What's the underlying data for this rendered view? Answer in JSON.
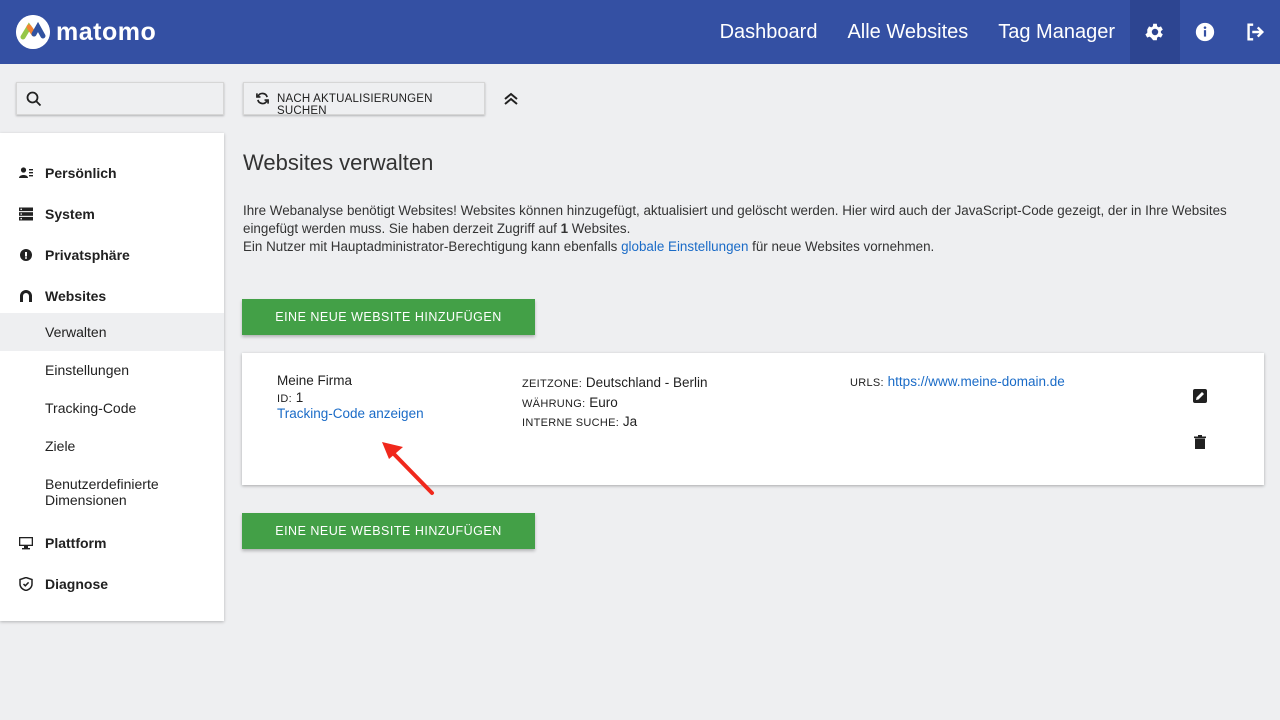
{
  "app": {
    "logo_text": "matomo"
  },
  "topnav": {
    "links": [
      "Dashboard",
      "Alle Websites",
      "Tag Manager"
    ],
    "icons": [
      "gear-icon",
      "info-icon",
      "logout-icon"
    ]
  },
  "search": {
    "placeholder": ""
  },
  "sidebar": {
    "categories": [
      {
        "label": "Persönlich",
        "icon": "user-icon"
      },
      {
        "label": "System",
        "icon": "server-icon"
      },
      {
        "label": "Privatsphäre",
        "icon": "privacy-icon"
      },
      {
        "label": "Websites",
        "icon": "website-icon"
      },
      {
        "label": "Plattform",
        "icon": "monitor-icon"
      },
      {
        "label": "Diagnose",
        "icon": "shield-icon"
      }
    ],
    "websites_sub": [
      "Verwalten",
      "Einstellungen",
      "Tracking-Code",
      "Ziele",
      "Benutzerdefinierte Dimensionen"
    ]
  },
  "toolbar": {
    "update_label": "NACH AKTUALISIERUNGEN SUCHEN"
  },
  "main": {
    "title": "Websites verwalten",
    "intro_part1": "Ihre Webanalyse benötigt Websites! Websites können hinzugefügt, aktualisiert und gelöscht werden. Hier wird auch der JavaScript-Code gezeigt, der in Ihre Websites eingefügt werden muss. Sie haben derzeit Zugriff auf ",
    "intro_count": "1",
    "intro_part2": " Websites.",
    "intro_line2_a": "Ein Nutzer mit Hauptadministrator-Berechtigung kann ebenfalls ",
    "intro_link": "globale Einstellungen",
    "intro_line2_b": " für neue Websites vornehmen.",
    "add_button": "EINE NEUE WEBSITE HINZUFÜGEN"
  },
  "site": {
    "name": "Meine Firma",
    "id_label": "ID:",
    "id_value": "1",
    "tracking_link": "Tracking-Code anzeigen",
    "timezone_label": "ZEITZONE:",
    "timezone_value": "Deutschland - Berlin",
    "currency_label": "WÄHRUNG:",
    "currency_value": "Euro",
    "search_label": "INTERNE SUCHE:",
    "search_value": "Ja",
    "urls_label": "URLS:",
    "urls_value": "https://www.meine-domain.de"
  },
  "colors": {
    "header": "#3450a3",
    "accent": "#43a047",
    "link": "#1a6bc7",
    "arrow": "#f0281c"
  }
}
